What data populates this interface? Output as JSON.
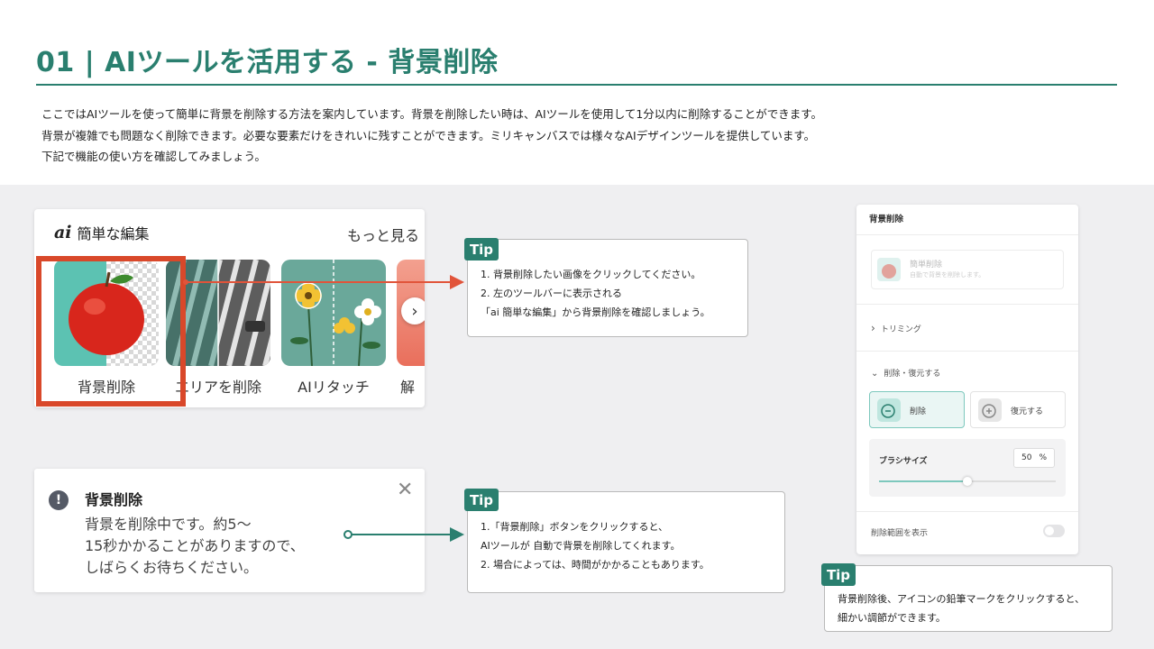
{
  "header": {
    "title": "01 | AIツールを活用する - 背景削除",
    "intro": [
      "ここではAIツールを使って簡単に背景を削除する方法を案内しています。背景を削除したい時は、AIツールを使用して1分以内に削除することができます。",
      "背景が複雑でも問題なく削除できます。必要な要素だけをきれいに残すことができます。ミリキャンバスでは様々なAIデザインツールを提供しています。",
      "下記で機能の使い方を確認してみましょう。"
    ]
  },
  "edit_panel": {
    "logo": "ai",
    "heading": "簡単な編集",
    "more": "もっと見る",
    "tools": [
      {
        "label": "背景削除"
      },
      {
        "label": "エリアを削除"
      },
      {
        "label": "AIリタッチ"
      },
      {
        "label": "解"
      }
    ],
    "next_icon": "chevron-right-icon"
  },
  "tip1": {
    "badge": "Tip",
    "lines": [
      "1. 背景削除したい画像をクリックしてください。",
      "2. 左のツールバーに表示される",
      "「ai 簡単な編集」から背景削除を確認しましょう。"
    ]
  },
  "notice": {
    "icon": "!",
    "title": "背景削除",
    "lines": [
      "背景を削除中です。約5～",
      "15秒かかることがありますので、",
      "しばらくお待ちください。"
    ],
    "close": "✕"
  },
  "tip2": {
    "badge": "Tip",
    "lines": [
      "1.「背景削除」ボタンをクリックすると、",
      "AIツールが 自動で背景を削除してくれます。",
      "2. 場合によっては、時間がかかることもあります。"
    ]
  },
  "settings_panel": {
    "title": "背景削除",
    "auto": {
      "title": "簡単削除",
      "subtitle": "自動で背景を削除します。"
    },
    "trimming": "トリミング",
    "erase_restore": "削除・復元する",
    "erase_btn": "削除",
    "restore_btn": "復元する",
    "brush_label": "ブラシサイズ",
    "brush_value": "50",
    "brush_unit": "%",
    "brush_level": 0.5,
    "show_range": "削除範囲を表示"
  },
  "tip3": {
    "badge": "Tip",
    "lines": [
      "背景削除後、アイコンの鉛筆マークをクリックすると、",
      "細かい調節ができます。"
    ]
  },
  "colors": {
    "accent": "#2a7f6f",
    "highlight": "#d9482a",
    "arrow_red": "#e1543a"
  }
}
